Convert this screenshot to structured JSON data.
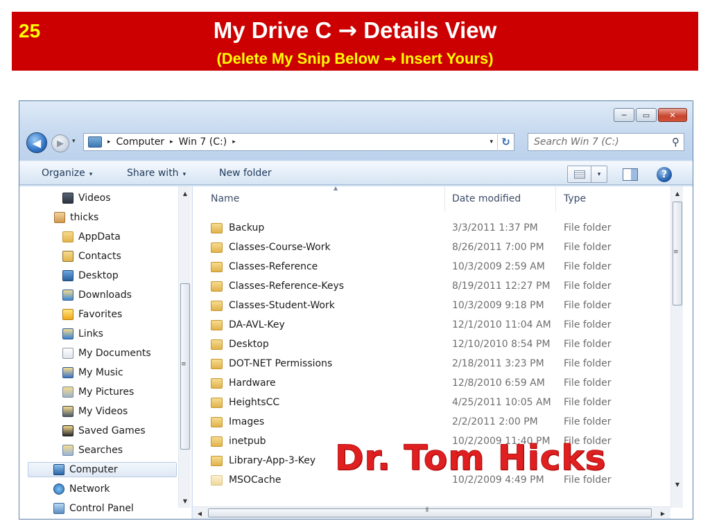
{
  "slide": {
    "number": "25",
    "title_before": "My Drive C",
    "title_after": "Details View",
    "subtitle_before": "(Delete My Snip Below",
    "subtitle_after": "Insert Yours)",
    "arrow": "→"
  },
  "window": {
    "controls": {
      "minimize": "─",
      "maximize": "▭",
      "close": "✕"
    },
    "nav": {
      "back_icon": "◀",
      "forward_icon": "▶",
      "recent_icon": "▾"
    },
    "breadcrumb": {
      "computer": "Computer",
      "drive": "Win 7 (C:)",
      "separator": "▸"
    },
    "address_drop": "▾",
    "refresh_icon": "↻",
    "search": {
      "placeholder": "Search Win 7 (C:)",
      "icon": "⚲"
    }
  },
  "toolbar": {
    "organize": "Organize",
    "share_with": "Share with",
    "new_folder": "New folder",
    "caret": "▾",
    "help": "?"
  },
  "navpane": {
    "items": [
      {
        "label": "Videos",
        "icon": "video-library-icon"
      },
      {
        "label": "thicks",
        "icon": "user-folder-icon"
      },
      {
        "label": "AppData",
        "icon": "folder-icon"
      },
      {
        "label": "Contacts",
        "icon": "contacts-icon"
      },
      {
        "label": "Desktop",
        "icon": "desktop-icon"
      },
      {
        "label": "Downloads",
        "icon": "downloads-icon"
      },
      {
        "label": "Favorites",
        "icon": "favorites-icon"
      },
      {
        "label": "Links",
        "icon": "links-icon"
      },
      {
        "label": "My Documents",
        "icon": "documents-icon"
      },
      {
        "label": "My Music",
        "icon": "music-icon"
      },
      {
        "label": "My Pictures",
        "icon": "pictures-icon"
      },
      {
        "label": "My Videos",
        "icon": "videos-icon"
      },
      {
        "label": "Saved Games",
        "icon": "saved-games-icon"
      },
      {
        "label": "Searches",
        "icon": "searches-icon"
      },
      {
        "label": "Computer",
        "icon": "computer-icon",
        "selected": true
      },
      {
        "label": "Network",
        "icon": "network-icon"
      },
      {
        "label": "Control Panel",
        "icon": "control-panel-icon"
      }
    ]
  },
  "filelist": {
    "columns": {
      "name": "Name",
      "date": "Date modified",
      "type": "Type"
    },
    "rows": [
      {
        "name": "Backup",
        "date": "3/3/2011 1:37 PM",
        "type": "File folder"
      },
      {
        "name": "Classes-Course-Work",
        "date": "8/26/2011 7:00 PM",
        "type": "File folder"
      },
      {
        "name": "Classes-Reference",
        "date": "10/3/2009 2:59 AM",
        "type": "File folder"
      },
      {
        "name": "Classes-Reference-Keys",
        "date": "8/19/2011 12:27 PM",
        "type": "File folder"
      },
      {
        "name": "Classes-Student-Work",
        "date": "10/3/2009 9:18 PM",
        "type": "File folder"
      },
      {
        "name": "DA-AVL-Key",
        "date": "12/1/2010 11:04 AM",
        "type": "File folder"
      },
      {
        "name": "Desktop",
        "date": "12/10/2010 8:54 PM",
        "type": "File folder"
      },
      {
        "name": "DOT-NET Permissions",
        "date": "2/18/2011 3:23 PM",
        "type": "File folder"
      },
      {
        "name": "Hardware",
        "date": "12/8/2010 6:59 AM",
        "type": "File folder"
      },
      {
        "name": "HeightsCC",
        "date": "4/25/2011 10:05 AM",
        "type": "File folder"
      },
      {
        "name": "Images",
        "date": "2/2/2011 2:00 PM",
        "type": "File folder"
      },
      {
        "name": "inetpub",
        "date": "10/2/2009 11:40 PM",
        "type": "File folder"
      },
      {
        "name": "Library-App-3-Key",
        "date": "",
        "type": ""
      },
      {
        "name": "MSOCache",
        "date": "10/2/2009 4:49 PM",
        "type": "File folder"
      }
    ]
  },
  "watermark": "Dr. Tom Hicks"
}
